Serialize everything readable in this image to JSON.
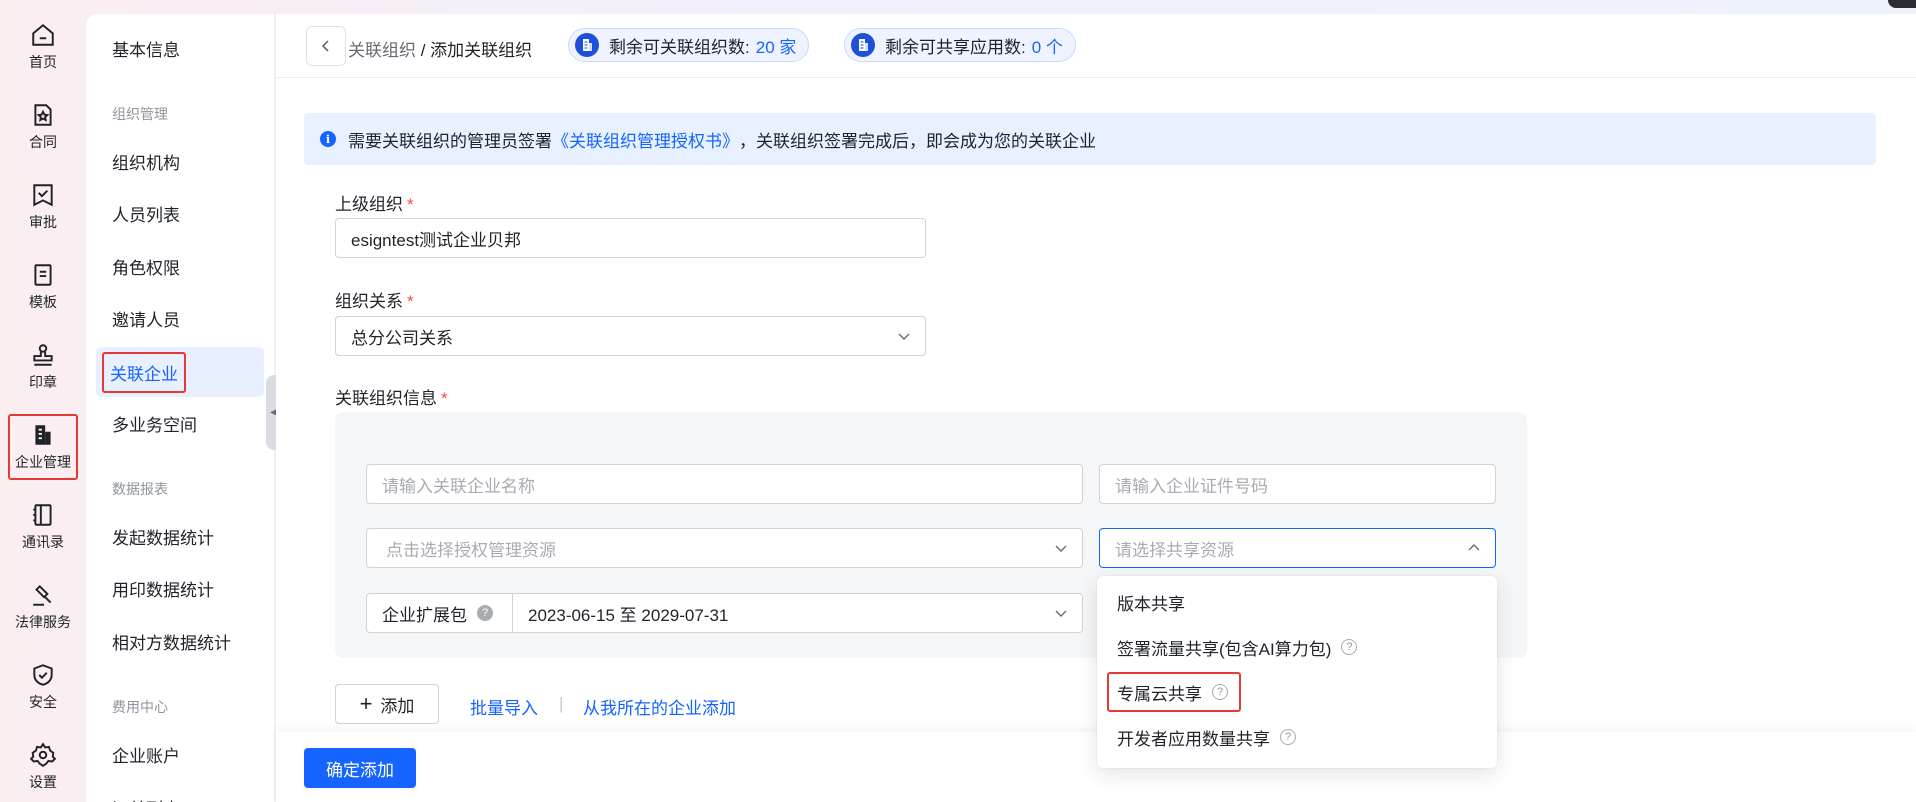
{
  "rail": {
    "items": [
      {
        "label": "首页",
        "icon": "home-icon"
      },
      {
        "label": "合同",
        "icon": "contract-icon"
      },
      {
        "label": "审批",
        "icon": "approval-icon"
      },
      {
        "label": "模板",
        "icon": "template-icon"
      },
      {
        "label": "印章",
        "icon": "seal-icon"
      },
      {
        "label": "企业管理",
        "icon": "enterprise-icon"
      },
      {
        "label": "通讯录",
        "icon": "contacts-icon"
      },
      {
        "label": "法律服务",
        "icon": "legal-icon"
      },
      {
        "label": "安全",
        "icon": "security-icon"
      },
      {
        "label": "设置",
        "icon": "settings-icon"
      }
    ]
  },
  "subnav": {
    "basic": "基本信息",
    "group_org": "组织管理",
    "org_items": [
      "组织机构",
      "人员列表",
      "角色权限",
      "邀请人员",
      "关联企业",
      "多业务空间"
    ],
    "group_report": "数据报表",
    "report_items": [
      "发起数据统计",
      "用印数据统计",
      "相对方数据统计"
    ],
    "group_fee": "费用中心",
    "fee_items": [
      "企业账户",
      "订单列表"
    ]
  },
  "header": {
    "crumb_parent": "关联组织",
    "crumb_sep": " / ",
    "crumb_current": "添加关联组织",
    "chip1_label": "剩余可关联组织数:",
    "chip1_value": "20 家",
    "chip2_label": "剩余可共享应用数:",
    "chip2_value": "0 个"
  },
  "alert": {
    "prefix": "需要关联组织的管理员签署",
    "link": "《关联组织管理授权书》",
    "suffix": "，关联组织签署完成后，即会成为您的关联企业"
  },
  "form": {
    "parent_label": "上级组织",
    "parent_value": "esigntest测试企业贝邦",
    "relation_label": "组织关系",
    "relation_value": "总分公司关系",
    "info_label": "关联组织信息",
    "required_mark": "*",
    "name_placeholder": "请输入关联企业名称",
    "cert_placeholder": "请输入企业证件号码",
    "auth_placeholder": "点击选择授权管理资源",
    "share_placeholder": "请选择共享资源",
    "ext_label": "企业扩展包",
    "ext_value": "2023-06-15 至 2029-07-31"
  },
  "actions": {
    "add": "添加",
    "batch_import": "批量导入",
    "divider": "|",
    "add_from_mine": "从我所在的企业添加",
    "confirm": "确定添加"
  },
  "dropdown": {
    "items": [
      {
        "label": "版本共享",
        "help": false
      },
      {
        "label": "签署流量共享(包含AI算力包)",
        "help": true
      },
      {
        "label": "专属云共享",
        "help": true
      },
      {
        "label": "开发者应用数量共享",
        "help": true
      }
    ]
  },
  "colors": {
    "primary": "#1664ff",
    "highlight": "#e53935",
    "required": "#f54a45"
  }
}
